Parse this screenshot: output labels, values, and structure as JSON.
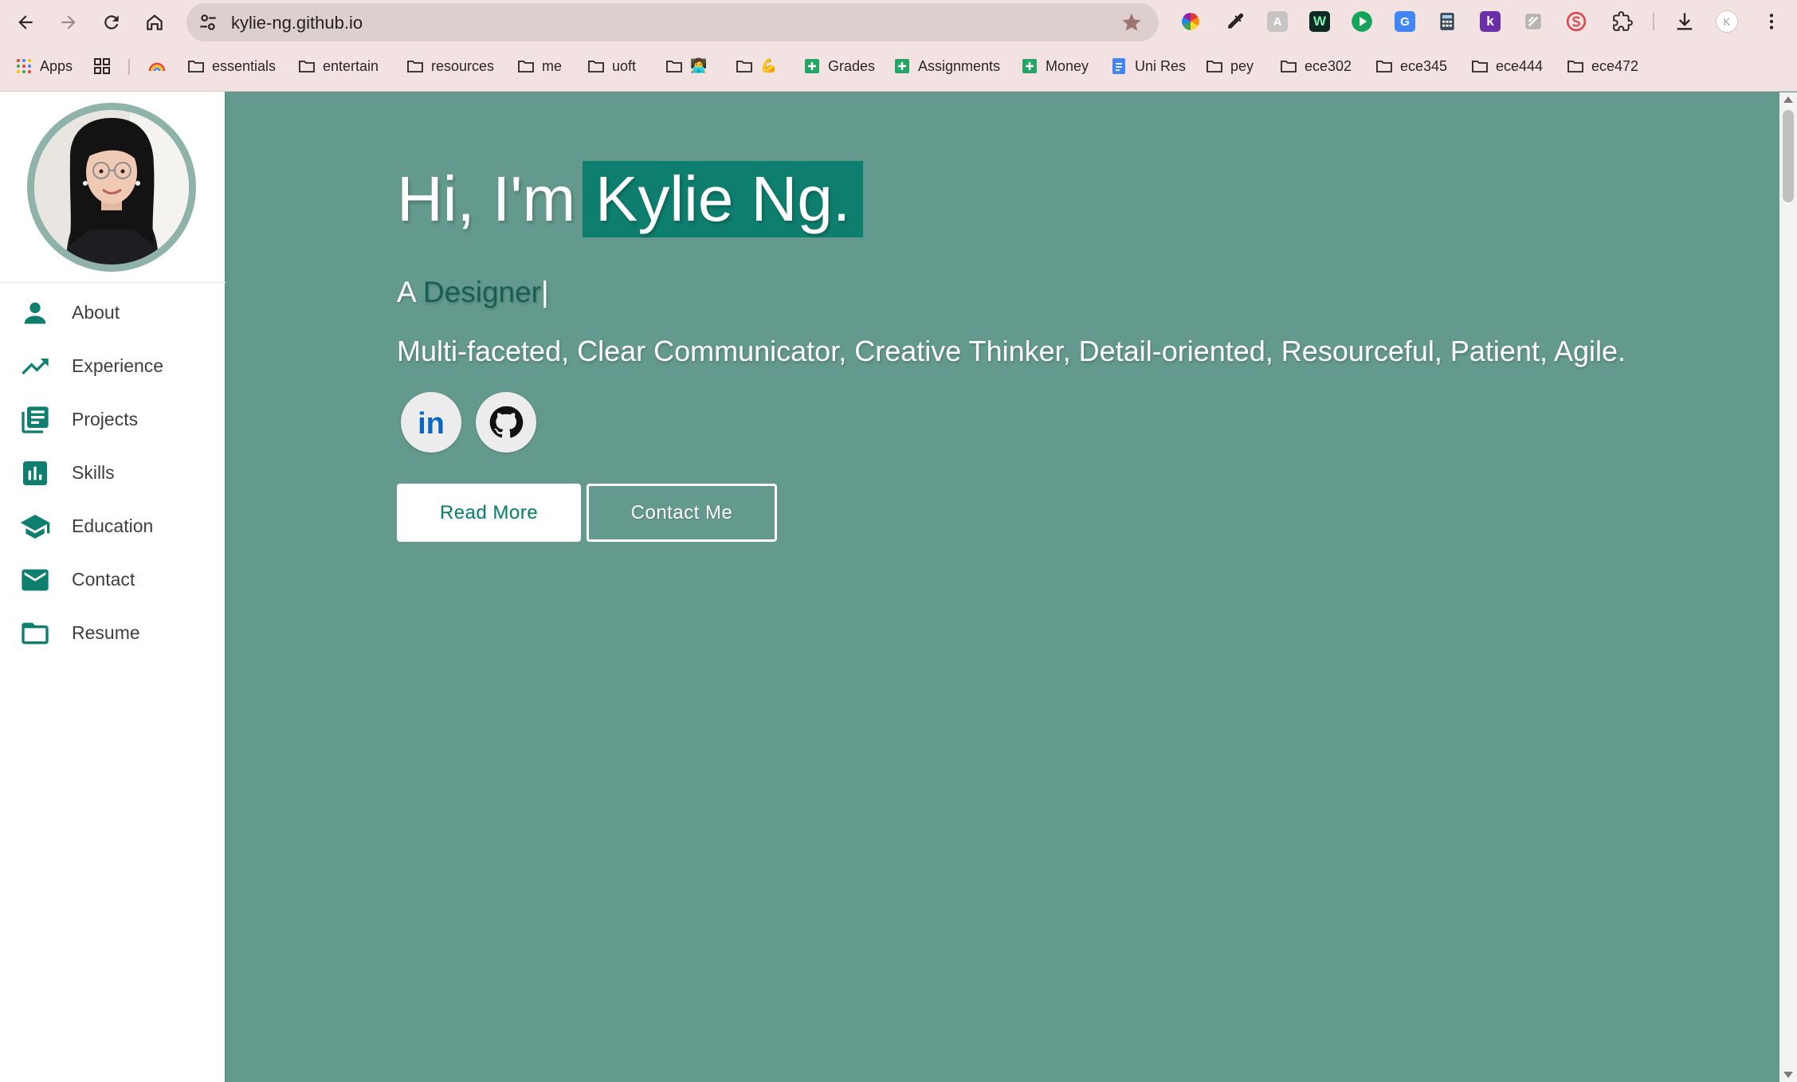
{
  "browser": {
    "url": "kylie-ng.github.io",
    "bookmarks": [
      {
        "label": "Apps",
        "icon": "apps-grid-icon"
      },
      {
        "label": "",
        "icon": "grid-icon"
      },
      {
        "label": "",
        "icon": "rainbow-icon"
      },
      {
        "label": "essentials",
        "icon": "folder-icon"
      },
      {
        "label": "entertain",
        "icon": "folder-icon"
      },
      {
        "label": "resources",
        "icon": "folder-icon"
      },
      {
        "label": "me",
        "icon": "folder-icon"
      },
      {
        "label": "uoft",
        "icon": "folder-icon"
      },
      {
        "label": "👩‍💻",
        "icon": "folder-icon"
      },
      {
        "label": "💪",
        "icon": "folder-icon"
      },
      {
        "label": "Grades",
        "icon": "sheets-icon"
      },
      {
        "label": "Assignments",
        "icon": "sheets-icon"
      },
      {
        "label": "Money",
        "icon": "sheets-icon"
      },
      {
        "label": "Uni Res",
        "icon": "docs-icon"
      },
      {
        "label": "pey",
        "icon": "folder-icon"
      },
      {
        "label": "ece302",
        "icon": "folder-icon"
      },
      {
        "label": "ece345",
        "icon": "folder-icon"
      },
      {
        "label": "ece444",
        "icon": "folder-icon"
      },
      {
        "label": "ece472",
        "icon": "folder-icon"
      }
    ],
    "extensions": {
      "writer": "W",
      "kami": "k",
      "grammarly": "G",
      "translate": "G"
    },
    "profile_initial": "K"
  },
  "sidebar": {
    "nav": [
      {
        "label": "About",
        "icon": "person-icon"
      },
      {
        "label": "Experience",
        "icon": "trending-up-icon"
      },
      {
        "label": "Projects",
        "icon": "library-books-icon"
      },
      {
        "label": "Skills",
        "icon": "bar-chart-icon"
      },
      {
        "label": "Education",
        "icon": "graduation-cap-icon"
      },
      {
        "label": "Contact",
        "icon": "mail-icon"
      },
      {
        "label": "Resume",
        "icon": "folder-open-icon"
      }
    ]
  },
  "hero": {
    "greeting": "Hi, I'm",
    "name": "Kylie Ng.",
    "typed_prefix": "A",
    "typed_role": "Designer",
    "typed_cursor": "|",
    "traits": "Multi-faceted, Clear Communicator, Creative Thinker, Detail-oriented, Resourceful, Patient, Agile.",
    "social": [
      {
        "label": "in",
        "icon": "linkedin-icon"
      },
      {
        "label": "",
        "icon": "github-icon"
      }
    ],
    "read_more": "Read More",
    "contact_me": "Contact Me"
  },
  "colors": {
    "accent": "#0e7f6f",
    "main_bg": "#649a8d",
    "chrome_bg": "#f2e3e2"
  }
}
